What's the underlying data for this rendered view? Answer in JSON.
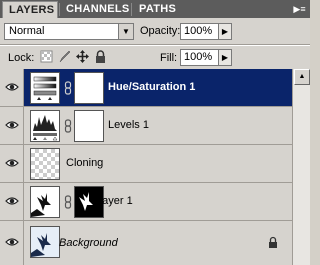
{
  "tabs": [
    {
      "label": "LAYERS",
      "active": true
    },
    {
      "label": "CHANNELS",
      "active": false
    },
    {
      "label": "PATHS",
      "active": false
    }
  ],
  "panel_menu_icon": "panel-menu-icon",
  "blend_mode": {
    "value": "Normal"
  },
  "opacity": {
    "label": "Opacity:",
    "value": "100%"
  },
  "lock": {
    "label": "Lock:",
    "icons": [
      "lock-transparent-icon",
      "lock-image-icon",
      "lock-position-icon",
      "lock-all-icon"
    ]
  },
  "fill": {
    "label": "Fill:",
    "value": "100%"
  },
  "layers": [
    {
      "name": "Hue/Saturation 1",
      "selected": true,
      "visible": true,
      "type": "adjustment",
      "linked_mask": true
    },
    {
      "name": "Levels 1",
      "selected": false,
      "visible": true,
      "type": "adjustment",
      "linked_mask": true
    },
    {
      "name": "Cloning",
      "selected": false,
      "visible": true,
      "type": "transparent"
    },
    {
      "name": "Layer 1",
      "selected": false,
      "visible": true,
      "type": "image",
      "linked_mask": true
    },
    {
      "name": "Background",
      "selected": false,
      "visible": true,
      "type": "background",
      "locked": true
    }
  ],
  "colors": {
    "selection": "#0a246a",
    "panel": "#d6d3ce",
    "tabbar": "#5c5c5c"
  }
}
